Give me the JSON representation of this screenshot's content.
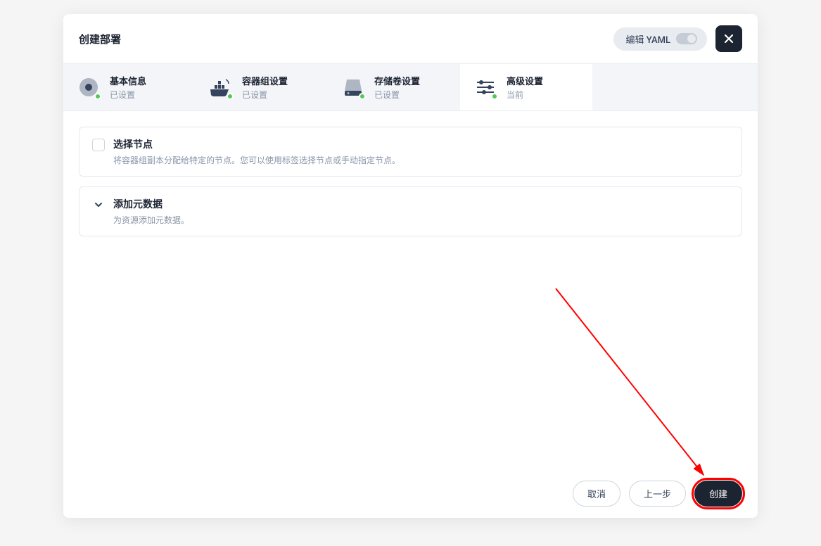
{
  "header": {
    "title": "创建部署",
    "yaml_label": "编辑 YAML"
  },
  "steps": [
    {
      "label": "基本信息",
      "status": "已设置",
      "icon": "record",
      "active": false
    },
    {
      "label": "容器组设置",
      "status": "已设置",
      "icon": "ship",
      "active": false
    },
    {
      "label": "存储卷设置",
      "status": "已设置",
      "icon": "disk",
      "active": false
    },
    {
      "label": "高级设置",
      "status": "当前",
      "icon": "sliders",
      "active": true
    }
  ],
  "cards": {
    "select_node": {
      "title": "选择节点",
      "desc": "将容器组副本分配给特定的节点。您可以使用标签选择节点或手动指定节点。"
    },
    "metadata": {
      "title": "添加元数据",
      "desc": "为资源添加元数据。"
    }
  },
  "footer": {
    "cancel": "取消",
    "prev": "上一步",
    "create": "创建"
  }
}
